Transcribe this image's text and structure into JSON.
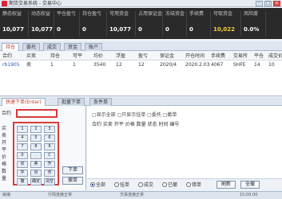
{
  "window": {
    "title": "期货交易系统 - 交易中心"
  },
  "account": [
    {
      "label": "静态权益",
      "value": "10,077"
    },
    {
      "label": "动态权益",
      "value": "10,077"
    },
    {
      "label": "平仓盈亏",
      "value": "0"
    },
    {
      "label": "持仓盈亏",
      "value": "0"
    },
    {
      "label": "可用资金",
      "value": "10,077"
    },
    {
      "label": "占用保证金",
      "value": "0"
    },
    {
      "label": "冻结资金",
      "value": "0"
    },
    {
      "label": "手续费",
      "value": "0"
    },
    {
      "label": "可取资金",
      "value": "10,022",
      "accent": "#f3d13b"
    },
    {
      "label": "风险度",
      "value": "0.0%"
    }
  ],
  "tabs": [
    "持仓",
    "委托",
    "成交",
    "资金",
    "账户"
  ],
  "grid": {
    "headers": [
      "合约",
      "买卖",
      "持仓",
      "可平",
      "均价",
      "浮盈",
      "盈亏",
      "保证金",
      "开仓时间",
      "手续费",
      "交易所",
      "平仓",
      "成交价"
    ],
    "row": [
      "rb1905",
      "卖",
      "1",
      "1",
      "3540",
      "12",
      "12",
      "2020/4",
      "2020.2.03",
      "4067",
      "SHFE",
      "14",
      "10"
    ]
  },
  "lowertabs": [
    "快速下单(Enter)",
    "批量下单",
    "条件单"
  ],
  "order": {
    "code_label": "合约",
    "code_placeholder": "",
    "side_labels": [
      "买卖",
      "开平",
      "价格",
      "数量"
    ],
    "keypad": [
      "1",
      "2",
      "3",
      "4",
      "5",
      "6",
      "7",
      "8",
      "9",
      "0",
      ".",
      "C",
      "买",
      "卖",
      "开",
      "平",
      "对",
      "市",
      "撤",
      "确定",
      "清空"
    ],
    "confirm": "下单",
    "cancel": "撤单",
    "warn": "价格"
  },
  "detail": {
    "options": "▢显示全部   ▢只显示挂单   ▢委托   ▢撤单",
    "columns": "合约   买卖   开平   价格   数量   状态   时间   编号"
  },
  "bottom": {
    "radios": [
      "全部",
      "挂单",
      "成交",
      "已撤",
      "错单"
    ],
    "refresh": "刷新",
    "cancel_all": "全撤"
  },
  "status": [
    "就绪",
    "行情连接正常",
    "交易连接正常",
    "15:00:00"
  ]
}
